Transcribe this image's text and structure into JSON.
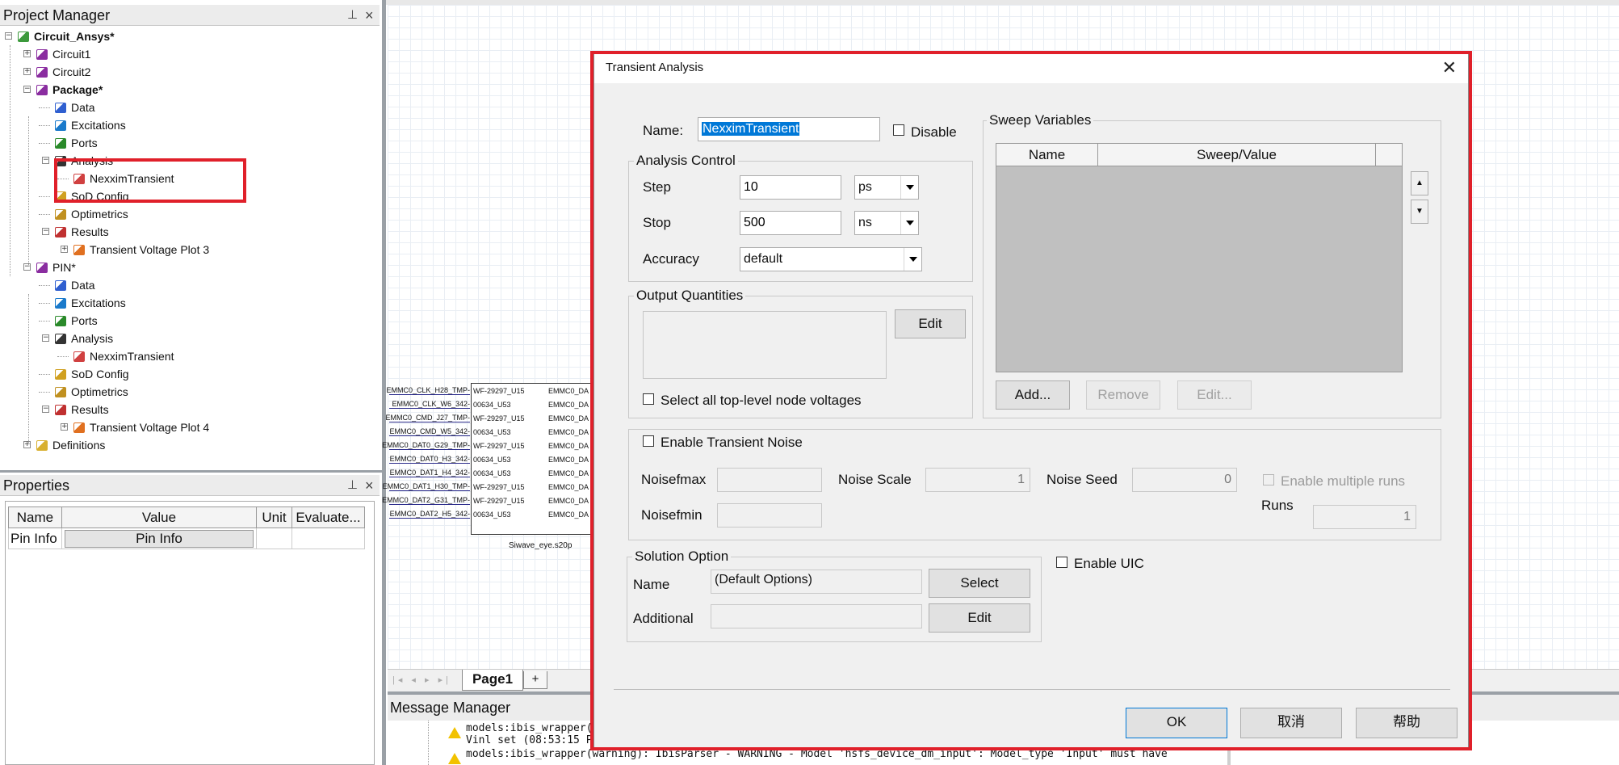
{
  "project_manager": {
    "title": "Project Manager",
    "pin": "📌",
    "close": "×",
    "tree": [
      {
        "label": "Circuit_Ansys*",
        "bold": true
      },
      {
        "label": "Circuit1"
      },
      {
        "label": "Circuit2"
      },
      {
        "label": "Package*",
        "bold": true
      },
      {
        "label": "Data"
      },
      {
        "label": "Excitations"
      },
      {
        "label": "Ports"
      },
      {
        "label": "Analysis"
      },
      {
        "label": "NexximTransient"
      },
      {
        "label": "SoD Config"
      },
      {
        "label": "Optimetrics"
      },
      {
        "label": "Results"
      },
      {
        "label": "Transient Voltage Plot 3"
      },
      {
        "label": "PIN*"
      },
      {
        "label": "Data"
      },
      {
        "label": "Excitations"
      },
      {
        "label": "Ports"
      },
      {
        "label": "Analysis"
      },
      {
        "label": "NexximTransient"
      },
      {
        "label": "SoD Config"
      },
      {
        "label": "Optimetrics"
      },
      {
        "label": "Results"
      },
      {
        "label": "Transient Voltage Plot 4"
      },
      {
        "label": "Definitions"
      }
    ]
  },
  "properties": {
    "title": "Properties",
    "pin": "📌",
    "close": "×",
    "columns": [
      "Name",
      "Value",
      "Unit",
      "Evaluate..."
    ],
    "rows": [
      {
        "name": "Pin Info",
        "value": "Pin Info",
        "unit": "",
        "evaluate": ""
      }
    ]
  },
  "schematic": {
    "left_labels": [
      "EMMC0_CLK_H28_TMP-",
      "EMMC0_CLK_W6_342-",
      "EMMC0_CMD_J27_TMP-",
      "EMMC0_CMD_W5_342-",
      "EMMC0_DAT0_G29_TMP-",
      "EMMC0_DAT0_H3_342-",
      "EMMC0_DAT1_H4_342-",
      "EMMC0_DAT1_H30_TMP-",
      "EMMC0_DAT2_G31_TMP-",
      "EMMC0_DAT2_H5_342-"
    ],
    "mid_labels": [
      "WF-29297_U15",
      "00634_U53",
      "WF-29297_U15",
      "00634_U53",
      "WF-29297_U15",
      "00634_U53",
      "00634_U53",
      "WF-29297_U15",
      "WF-29297_U15",
      "00634_U53"
    ],
    "right_labels": [
      "EMMC0_DA",
      "EMMC0_DA",
      "EMMC0_DA",
      "EMMC0_DA",
      "EMMC0_DA",
      "EMMC0_DA",
      "EMMC0_DA",
      "EMMC0_DA",
      "EMMC0_DA",
      "EMMC0_DA"
    ],
    "component_name": "Siwave_eye.s20p",
    "page_tab": "Page1",
    "add_tab": "+",
    "nav_arrows": "|◂ ◂ ▸ ▸|"
  },
  "message_manager": {
    "title": "Message Manager",
    "lines": [
      "models:ibis_wrapper(w",
      "Vinl set (08:53:15 P",
      "models:ibis_wrapper(warning): IbisParser - WARNING - Model 'hsfs_device_dm_input': Model_type 'Input' must have"
    ]
  },
  "dialog": {
    "title": "Transient Analysis",
    "close": "✕",
    "name_label": "Name:",
    "name_value": "NexximTransient",
    "disable_label": "Disable",
    "analysis_control": {
      "title": "Analysis Control",
      "step_label": "Step",
      "step_value": "10",
      "step_unit": "ps",
      "stop_label": "Stop",
      "stop_value": "500",
      "stop_unit": "ns",
      "accuracy_label": "Accuracy",
      "accuracy_value": "default"
    },
    "output_quantities": {
      "title": "Output Quantities",
      "edit_button": "Edit",
      "select_all_label": "Select all top-level node voltages"
    },
    "sweep_variables": {
      "title": "Sweep Variables",
      "columns": [
        "Name",
        "Sweep/Value"
      ],
      "add_button": "Add...",
      "remove_button": "Remove",
      "edit_button": "Edit...",
      "up_arrow": "▲",
      "down_arrow": "▼"
    },
    "noise": {
      "enable_label": "Enable Transient Noise",
      "noisefmax_label": "Noisefmax",
      "noisefmin_label": "Noisefmin",
      "noise_scale_label": "Noise Scale",
      "noise_scale_value": "1",
      "noise_seed_label": "Noise Seed",
      "noise_seed_value": "0",
      "enable_multiple_runs_label": "Enable multiple runs",
      "runs_label": "Runs",
      "runs_value": "1"
    },
    "solution_option": {
      "title": "Solution Option",
      "name_label": "Name",
      "name_value": "(Default Options)",
      "select_button": "Select",
      "additional_label": "Additional",
      "additional_value": "",
      "edit_button": "Edit"
    },
    "enable_uic_label": "Enable UIC",
    "ok_button": "OK",
    "cancel_button": "取消",
    "help_button": "帮助"
  },
  "colors": {
    "highlight": "#e0202a",
    "selection": "#0078d7",
    "dialog_bg": "#f0f0f0",
    "table_body": "#c0c0c0"
  }
}
